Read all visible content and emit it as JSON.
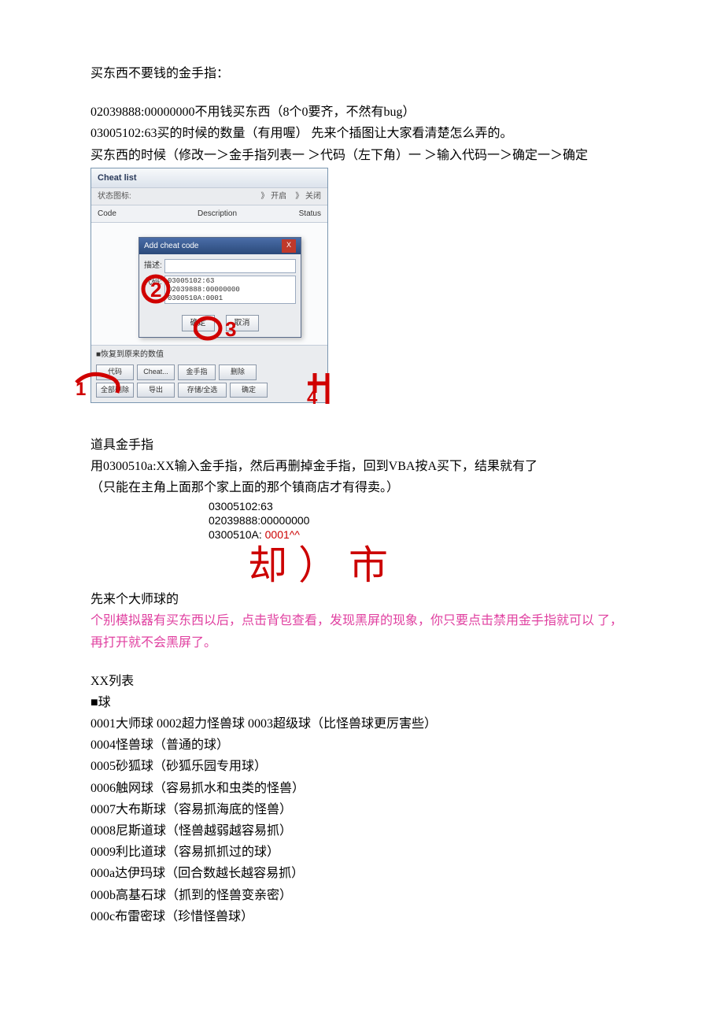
{
  "intro": {
    "title": "买东西不要钱的金手指：",
    "line1": "02039888:00000000不用钱买东西（8个0要齐，不然有bug）",
    "line2": "03005102:63买的时候的数量（有用喔） 先来个插图让大家看清楚怎么弄的。",
    "line3": "买东西的时候（修改一＞金手指列表一 ＞代码（左下角）一 ＞输入代码一＞确定一＞确定"
  },
  "cheat_window": {
    "title": "Cheat list",
    "status_label": "状态图标:",
    "open_label": "》 开启",
    "close_label": "》 关闭",
    "col_code": "Code",
    "col_desc": "Description",
    "col_status": "Status",
    "dialog_title": "Add cheat code",
    "dialog_close": "X",
    "desc_label": "描述:",
    "code_label": "代码:",
    "code_value1": "03005102:63",
    "code_value2": "02039888:00000000",
    "code_value3": "0300510A:0001",
    "btn_ok": "确定",
    "btn_cancel": "取消",
    "checkbox_label": "■恢复到原来的数值",
    "tb1": "代码",
    "tb2": "Cheat...",
    "tb3": "金手指",
    "tb4": "删除",
    "tb5": "全部删除",
    "tb6": "导出",
    "tb7": "存储/全选",
    "tb8": "确定",
    "annot1": "1",
    "annot2": "2",
    "annot3": "3",
    "annot4": "4"
  },
  "section2": {
    "title": "道具金手指",
    "line1": "用0300510a:XX输入金手指，然后再删掉金手指，回到VBA按A买下，结果就有了",
    "line2": "（只能在主角上面那个家上面的那个镇商店才有得卖。）",
    "code1": "03005102:63",
    "code2": "02039888:00000000",
    "code3_pre": "0300510A: ",
    "code3_red": "0001^^",
    "big_red": "却）市",
    "line3": "先来个大师球的",
    "pink": "个别模拟器有买东西以后，点击背包查看，发现黑屏的现象，你只要点击禁用金手指就可以 了，再打开就不会黑屏了。"
  },
  "xxlist": {
    "title": "XX列表",
    "cat": "■球",
    "items": [
      "0001大师球 0002超力怪兽球 0003超级球（比怪兽球更厉害些）",
      "0004怪兽球（普通的球）",
      "0005砂狐球（砂狐乐园专用球）",
      "0006触网球（容易抓水和虫类的怪兽）",
      "0007大布斯球（容易抓海底的怪兽）",
      "0008尼斯道球（怪兽越弱越容易抓）",
      "0009利比道球（容易抓抓过的球）",
      "000a达伊玛球（回合数越长越容易抓）",
      "000b高基石球（抓到的怪兽变亲密）",
      "000c布雷密球（珍惜怪兽球）"
    ]
  }
}
